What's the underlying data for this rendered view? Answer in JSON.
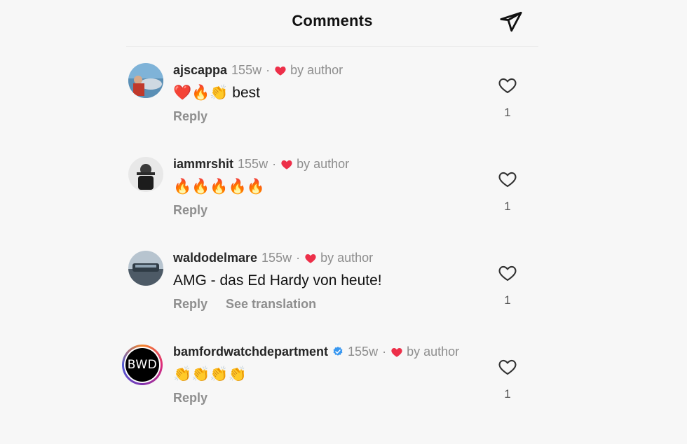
{
  "header": {
    "title": "Comments",
    "share_icon": "paper-plane-icon"
  },
  "colors": {
    "heart_red": "#ed2f49",
    "verified_blue": "#3897f0",
    "muted_text": "#8e8e8e"
  },
  "comments": [
    {
      "username": "ajscappa",
      "verified": false,
      "time": "155w",
      "separator": "·",
      "author_like": "by author",
      "text": "❤️🔥👏 best",
      "reply_label": "Reply",
      "translate_label": "",
      "like_count": "1",
      "avatar": "photo-avatar"
    },
    {
      "username": "iammrshit",
      "verified": false,
      "time": "155w",
      "separator": "·",
      "author_like": "by author",
      "text": "🔥🔥🔥🔥🔥",
      "reply_label": "Reply",
      "translate_label": "",
      "like_count": "1",
      "avatar": "photo-avatar"
    },
    {
      "username": "waldodelmare",
      "verified": false,
      "time": "155w",
      "separator": "·",
      "author_like": "by author",
      "text": "AMG - das Ed Hardy von heute!",
      "reply_label": "Reply",
      "translate_label": "See translation",
      "like_count": "1",
      "avatar": "photo-avatar"
    },
    {
      "username": "bamfordwatchdepartment",
      "verified": true,
      "time": "155w",
      "separator": "·",
      "author_like": "by author",
      "text": "👏👏👏👏",
      "reply_label": "Reply",
      "translate_label": "",
      "like_count": "1",
      "avatar": "logo-avatar",
      "avatar_text": "BWD"
    }
  ]
}
